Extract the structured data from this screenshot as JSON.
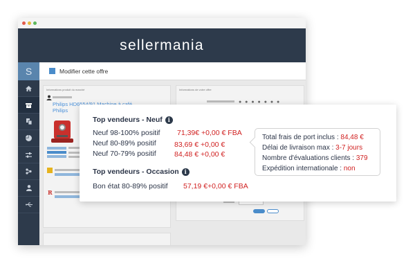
{
  "app": {
    "brand": "sellermania",
    "sidebar_logo": "S",
    "page_title": "Modifier cette offre",
    "left_panel_title": "Informations produit du marché",
    "right_panel_title": "Informations de votre offre",
    "product_name": "Philips HD6554/91 Machine à café",
    "product_brand": "Philips"
  },
  "sidebar": {
    "icons": [
      "home-icon",
      "box-icon",
      "copy-icon",
      "chart-icon",
      "sliders-icon",
      "network-icon",
      "user-icon",
      "usb-icon"
    ]
  },
  "popup": {
    "new_title": "Top vendeurs - Neuf",
    "new_rows": [
      {
        "label": "Neuf 98-100% positif",
        "price": "71,39€ +0,00 € FBA"
      },
      {
        "label": "Neuf 80-89% positif",
        "price": "83,69 € +0,00 €"
      },
      {
        "label": "Neuf 70-79% positif",
        "price": "84,48 € +0,00 €"
      }
    ],
    "used_title": "Top vendeurs - Occasion",
    "used_rows": [
      {
        "label": "Bon état 80-89% positif",
        "price": "57,19 €+0,00 € FBA"
      }
    ],
    "info_glyph": "i"
  },
  "details": {
    "shipping_label": "Total frais de port inclus : ",
    "shipping_value": "84,48 €",
    "delivery_label": "Délai de livraison max : ",
    "delivery_value": "3-7 jours",
    "reviews_label": "Nombre d'évaluations clients : ",
    "reviews_value": "379",
    "intl_label": "Expédition internationale : ",
    "intl_value": "non"
  },
  "colors": {
    "navy": "#2d3a4b",
    "accent_blue": "#4a8cca",
    "price_red": "#d01f1f"
  }
}
